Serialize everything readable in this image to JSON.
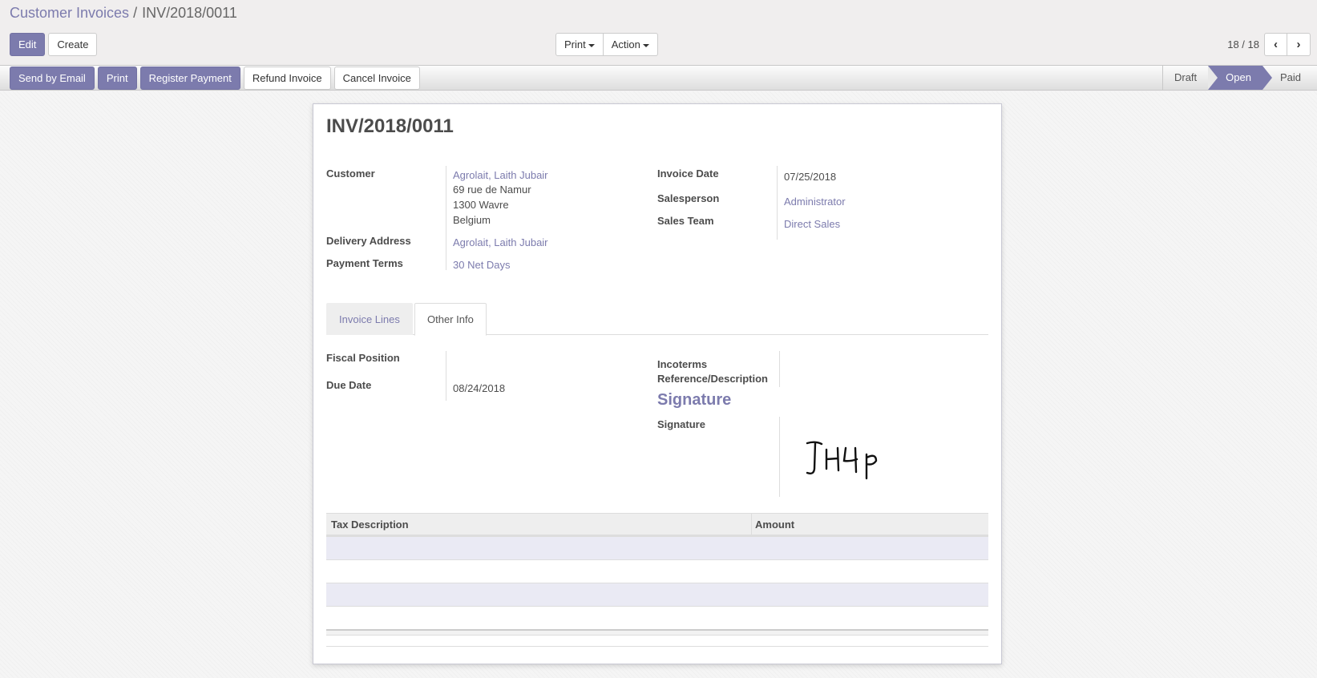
{
  "breadcrumb": {
    "parent": "Customer Invoices",
    "separator": "/",
    "current": "INV/2018/0011"
  },
  "toolbar": {
    "edit": "Edit",
    "create": "Create",
    "print": "Print",
    "action": "Action"
  },
  "pager": {
    "value": "18 / 18",
    "prev_icon": "chevron-left-icon",
    "next_icon": "chevron-right-icon"
  },
  "header_buttons": {
    "send_by_email": "Send by Email",
    "print": "Print",
    "register_payment": "Register Payment",
    "refund_invoice": "Refund Invoice",
    "cancel_invoice": "Cancel Invoice"
  },
  "status": {
    "draft": "Draft",
    "open": "Open",
    "paid": "Paid",
    "current": "Open"
  },
  "invoice": {
    "number": "INV/2018/0011",
    "customer_label": "Customer",
    "customer_name": "Agrolait, Laith Jubair",
    "address_line1": "69 rue de Namur",
    "address_line2": "1300 Wavre",
    "address_line3": "Belgium",
    "delivery_address_label": "Delivery Address",
    "delivery_address": "Agrolait, Laith Jubair",
    "payment_terms_label": "Payment Terms",
    "payment_terms": "30 Net Days",
    "invoice_date_label": "Invoice Date",
    "invoice_date": "07/25/2018",
    "salesperson_label": "Salesperson",
    "salesperson": "Administrator",
    "sales_team_label": "Sales Team",
    "sales_team": "Direct Sales"
  },
  "tabs": {
    "invoice_lines": "Invoice Lines",
    "other_info": "Other Info",
    "active": "Other Info"
  },
  "other_info": {
    "fiscal_position_label": "Fiscal Position",
    "fiscal_position": "",
    "due_date_label": "Due Date",
    "due_date": "08/24/2018",
    "incoterms_label": "Incoterms",
    "reference_label": "Reference/Description",
    "signature_heading": "Signature",
    "signature_label": "Signature",
    "signature_text": "Јнр"
  },
  "tax_table": {
    "col_description": "Tax Description",
    "col_amount": "Amount"
  },
  "colors": {
    "brand": "#7c7bad",
    "row_stripe": "#eaeaf4"
  }
}
